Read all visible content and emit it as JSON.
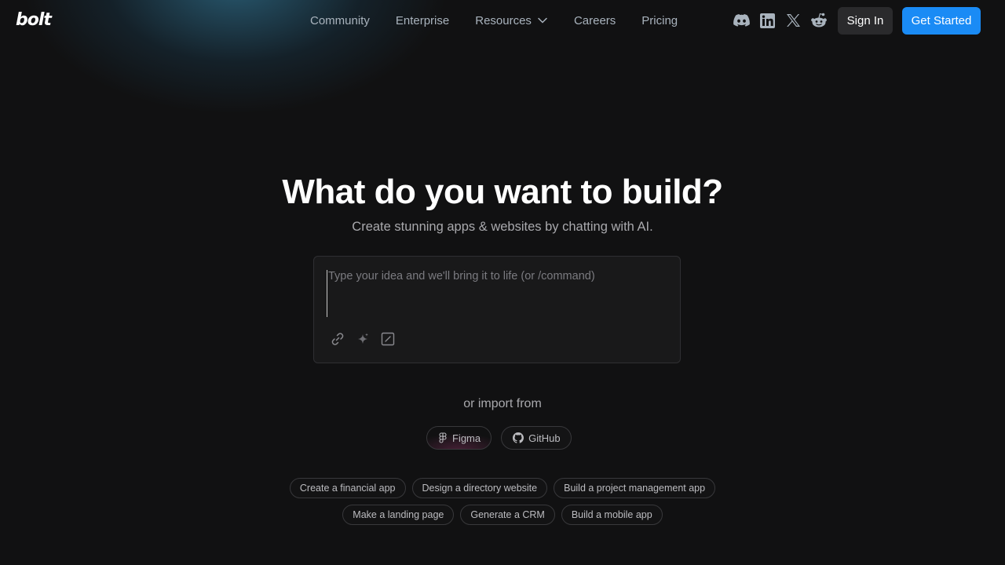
{
  "header": {
    "logo": "bolt",
    "nav": [
      {
        "label": "Community"
      },
      {
        "label": "Enterprise"
      },
      {
        "label": "Resources"
      },
      {
        "label": "Careers"
      },
      {
        "label": "Pricing"
      }
    ],
    "socials": [
      "discord-icon",
      "linkedin-icon",
      "x-icon",
      "reddit-icon"
    ],
    "sign_in": "Sign In",
    "get_started": "Get Started"
  },
  "hero": {
    "title": "What do you want to build?",
    "subtitle": "Create stunning apps & websites by chatting with AI."
  },
  "prompt": {
    "value": "",
    "placeholder": "Type your idea and we'll bring it to life (or /command)",
    "tools": [
      "link-icon",
      "sparkle-icon",
      "edit-icon"
    ]
  },
  "import": {
    "label": "or import from",
    "figma": "Figma",
    "github": "GitHub"
  },
  "suggestions": {
    "row1": [
      "Create a financial app",
      "Design a directory website",
      "Build a project management app"
    ],
    "row2": [
      "Make a landing page",
      "Generate a CRM",
      "Build a mobile app"
    ]
  },
  "colors": {
    "background": "#111112",
    "accent": "#1a8bf5",
    "glow": "#3a91b9"
  }
}
